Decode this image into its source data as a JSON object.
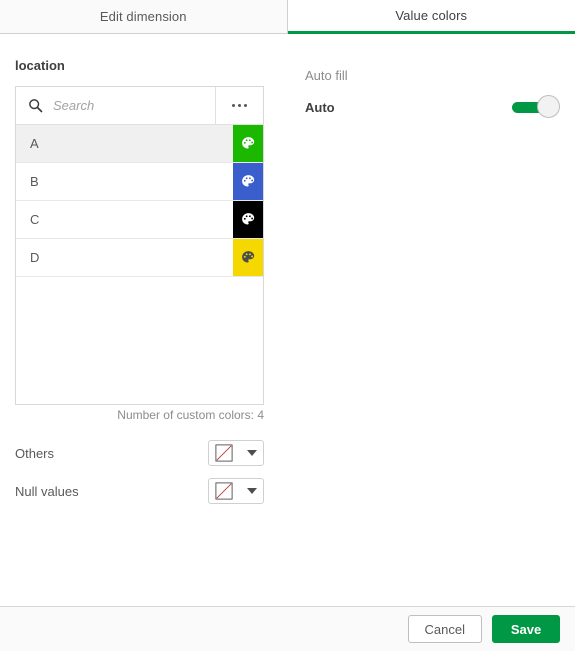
{
  "tabs": [
    {
      "label": "Edit dimension",
      "active": false,
      "name": "tab-edit-dimension"
    },
    {
      "label": "Value colors",
      "active": true,
      "name": "tab-value-colors"
    }
  ],
  "left_panel": {
    "field_label": "location",
    "search": {
      "placeholder": "Search",
      "value": "",
      "icon": "search-icon",
      "menu_icon": "kebab-menu-icon"
    },
    "values": [
      {
        "label": "A",
        "color": "#1CB800",
        "icon_color": "#ffffff",
        "highlighted": true
      },
      {
        "label": "B",
        "color": "#3A5FCD",
        "icon_color": "#ffffff",
        "highlighted": false
      },
      {
        "label": "C",
        "color": "#000000",
        "icon_color": "#ffffff",
        "highlighted": false
      },
      {
        "label": "D",
        "color": "#F5D800",
        "icon_color": "#4d4d4d",
        "highlighted": false
      }
    ],
    "custom_colors_text": "Number of custom colors: 4",
    "others": {
      "label": "Others",
      "swatch": "no-color",
      "caret": "chevron-down-icon"
    },
    "null_values": {
      "label": "Null values",
      "swatch": "no-color",
      "caret": "chevron-down-icon"
    }
  },
  "right_panel": {
    "section_header": "Auto fill",
    "auto": {
      "label": "Auto",
      "state": "on"
    }
  },
  "footer": {
    "cancel_label": "Cancel",
    "save_label": "Save"
  },
  "colors": {
    "accent_green": "#009845",
    "no_color_line": "#c0392b",
    "border": "#d8d8d8"
  }
}
